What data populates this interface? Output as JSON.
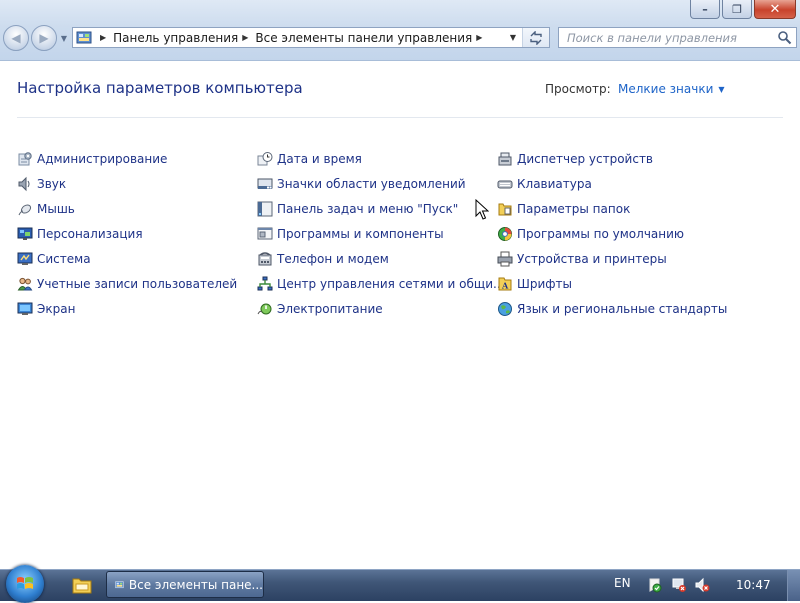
{
  "window": {
    "address_crumbs": [
      "Панель управления",
      "Все элементы панели управления"
    ],
    "search_placeholder": "Поиск в панели управления"
  },
  "content": {
    "title": "Настройка параметров компьютера",
    "view_label": "Просмотр:",
    "view_value": "Мелкие значки"
  },
  "items": {
    "col1": [
      {
        "label": "Администрирование",
        "icon": "admin-tools-icon"
      },
      {
        "label": "Звук",
        "icon": "speaker-icon"
      },
      {
        "label": "Мышь",
        "icon": "mouse-icon"
      },
      {
        "label": "Персонализация",
        "icon": "personalization-icon"
      },
      {
        "label": "Система",
        "icon": "system-icon"
      },
      {
        "label": "Учетные записи пользователей",
        "icon": "users-icon"
      },
      {
        "label": "Экран",
        "icon": "display-icon"
      }
    ],
    "col2": [
      {
        "label": "Дата и время",
        "icon": "clock-icon"
      },
      {
        "label": "Значки области уведомлений",
        "icon": "notification-area-icon"
      },
      {
        "label": "Панель задач и меню \"Пуск\"",
        "icon": "taskbar-icon"
      },
      {
        "label": "Программы и компоненты",
        "icon": "programs-icon"
      },
      {
        "label": "Телефон и модем",
        "icon": "phone-modem-icon"
      },
      {
        "label": "Центр управления сетями и общи...",
        "icon": "network-icon"
      },
      {
        "label": "Электропитание",
        "icon": "power-icon"
      }
    ],
    "col3": [
      {
        "label": "Диспетчер устройств",
        "icon": "device-manager-icon"
      },
      {
        "label": "Клавиатура",
        "icon": "keyboard-icon"
      },
      {
        "label": "Параметры папок",
        "icon": "folder-options-icon"
      },
      {
        "label": "Программы по умолчанию",
        "icon": "default-programs-icon"
      },
      {
        "label": "Устройства и принтеры",
        "icon": "printer-icon"
      },
      {
        "label": "Шрифты",
        "icon": "fonts-icon"
      },
      {
        "label": "Язык и региональные стандарты",
        "icon": "globe-icon"
      }
    ]
  },
  "taskbar": {
    "task_label": "Все элементы пане...",
    "lang": "EN",
    "clock": "10:47"
  }
}
